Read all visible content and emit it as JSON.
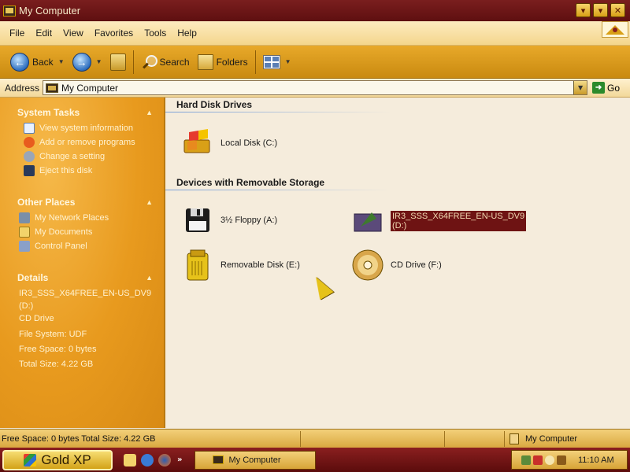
{
  "window": {
    "title": "My Computer",
    "controls": {
      "minimize": "▾",
      "maximize": "▾",
      "close": "✕"
    }
  },
  "menu": [
    "File",
    "Edit",
    "View",
    "Favorites",
    "Tools",
    "Help"
  ],
  "toolbar": {
    "back_label": "Back",
    "search_label": "Search",
    "folders_label": "Folders"
  },
  "address": {
    "label": "Address",
    "value": "My Computer",
    "go_label": "Go"
  },
  "sidebar": {
    "system_tasks": {
      "title": "System Tasks",
      "items": [
        "View system information",
        "Add or remove programs",
        "Change a setting",
        "Eject this disk"
      ]
    },
    "other_places": {
      "title": "Other Places",
      "items": [
        "My Network Places",
        "My Documents",
        "Control Panel"
      ]
    },
    "details": {
      "title": "Details",
      "name_line1": "IR3_SSS_X64FREE_EN-US_DV9",
      "name_line2": "(D:)",
      "type": "CD Drive",
      "file_system": "File System: UDF",
      "free_space": "Free Space: 0 bytes",
      "total_size": "Total Size: 4.22 GB"
    }
  },
  "content": {
    "hard_disk_title": "Hard Disk Drives",
    "removable_title": "Devices with Removable Storage",
    "drives": {
      "local_c": "Local Disk (C:)",
      "floppy_a": "3½ Floppy (A:)",
      "dvd_d_line1": "IR3_SSS_X64FREE_EN-US_DV9",
      "dvd_d_line2": "(D:)",
      "removable_e": "Removable Disk (E:)",
      "cd_f": "CD Drive (F:)"
    }
  },
  "status": {
    "left": "Free Space: 0 bytes Total Size: 4.22 GB",
    "location": "My Computer"
  },
  "taskbar": {
    "start_label": "Gold XP",
    "window_button": "My Computer",
    "clock": "11:10 AM"
  },
  "colors": {
    "title_bar": "#6e1313",
    "sidebar": "#e89a1e",
    "selection": "#6e1313"
  }
}
